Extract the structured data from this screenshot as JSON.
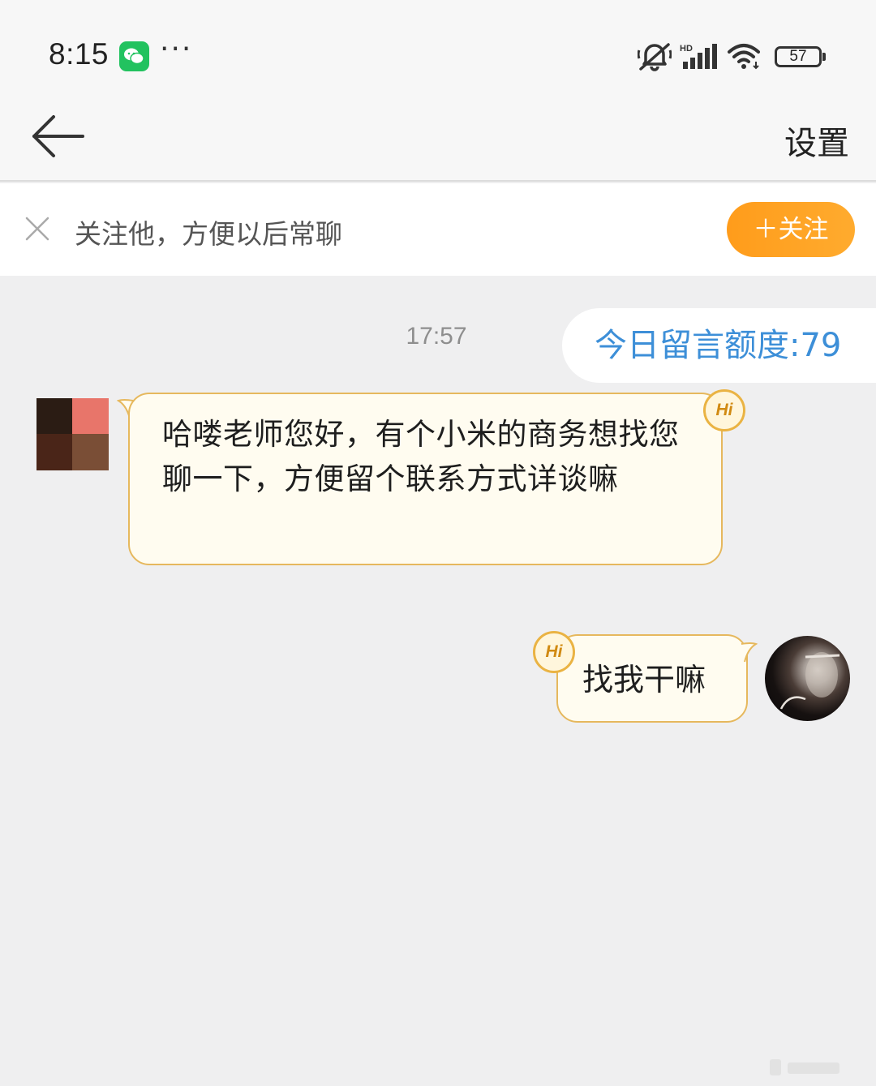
{
  "status_bar": {
    "time": "8:15",
    "notification_icons": [
      "wechat-icon",
      "more-dots-icon"
    ],
    "system_icons": [
      "mute-icon",
      "hd-signal-icon",
      "wifi-icon",
      "battery-icon"
    ],
    "battery_level": "57"
  },
  "nav": {
    "back_icon": "back-arrow-icon",
    "settings_label": "设置"
  },
  "follow_banner": {
    "close_icon": "close-icon",
    "text": "关注他，方便以后常聊",
    "follow_button": "＋关注"
  },
  "chat": {
    "timestamp": "17:57",
    "quota_label": "今日留言额度:79",
    "messages": [
      {
        "side": "left",
        "text": "哈喽老师您好，有个小米的商务想找您聊一下，方便留个联系方式详谈嘛",
        "badge": "Hi"
      },
      {
        "side": "right",
        "text": "找我干嘛",
        "badge": "Hi"
      }
    ]
  },
  "colors": {
    "accent_orange": "#ff9c1b",
    "quota_blue": "#3d8fd8",
    "bubble_fill": "#fffcf0",
    "bubble_border": "#e6b85d",
    "chat_background": "#efeff0"
  }
}
